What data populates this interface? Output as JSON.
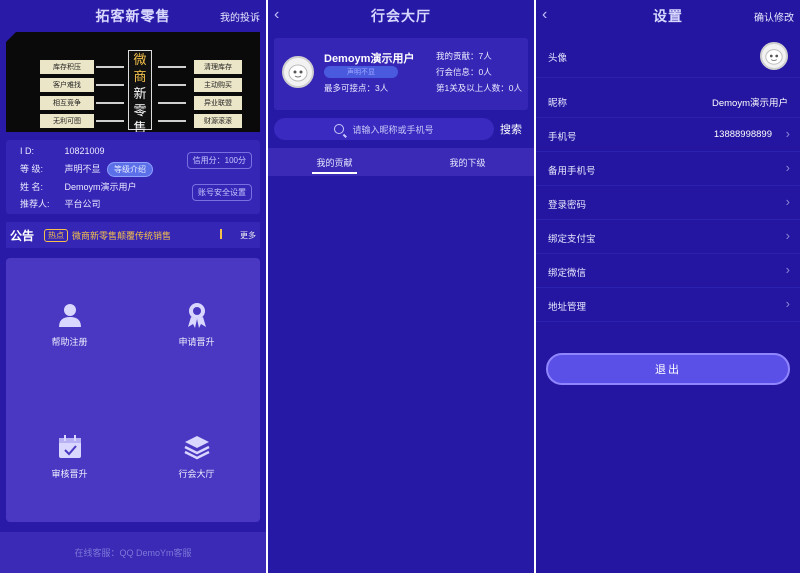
{
  "left": {
    "title": "拓客新零售",
    "top_right": "我的投诉",
    "banner": {
      "left_labels": [
        "库存积压",
        "客户难找",
        "相互竞争",
        "无利可图"
      ],
      "center": [
        "微",
        "商",
        "新",
        "零",
        "售"
      ],
      "right_labels": [
        "清理库存",
        "主动购买",
        "异业联盟",
        "财源滚滚"
      ]
    },
    "info": {
      "id_key": "I    D:",
      "id_val": "10821009",
      "level_key": "等    级:",
      "level_val": "声明不显",
      "level_btn": "等级介绍",
      "credit": "信用分：100分",
      "name_key": "姓    名:",
      "name_val": "Demoym演示用户",
      "security_btn": "账号安全设置",
      "ref_key": "推荐人:",
      "ref_val": "平台公司"
    },
    "notice": {
      "label": "公告",
      "hot": "热点",
      "msg": "微商新零售颠覆传统销售",
      "more": "更多"
    },
    "grid": [
      "帮助注册",
      "申请晋升",
      "审核晋升",
      "行会大厅"
    ],
    "footer": "在线客服：QQ DemoYm客服"
  },
  "middle": {
    "title": "行会大厅",
    "user": {
      "name": "Demoym演示用户",
      "tag": "声明不显",
      "max": "最多可接点：3人",
      "contrib": "我的贡献：7人",
      "guild": "行会信息：0人",
      "level1": "第1关及以上人数：0人"
    },
    "search": {
      "placeholder": "请输入昵称或手机号",
      "button": "搜索"
    },
    "tabs": [
      "我的贡献",
      "我的下级"
    ]
  },
  "right": {
    "title": "设置",
    "confirm": "确认修改",
    "rows": [
      {
        "key": "头像",
        "value": ""
      },
      {
        "key": "昵称",
        "value": "Demoym演示用户"
      },
      {
        "key": "手机号",
        "value": "13888998899"
      },
      {
        "key": "备用手机号",
        "value": ""
      },
      {
        "key": "登录密码",
        "value": ""
      },
      {
        "key": "绑定支付宝",
        "value": ""
      },
      {
        "key": "绑定微信",
        "value": ""
      },
      {
        "key": "地址管理",
        "value": ""
      }
    ],
    "logout": "退出"
  }
}
